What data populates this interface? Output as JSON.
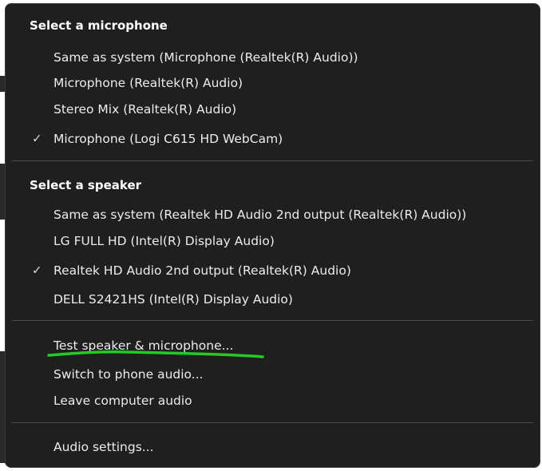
{
  "mic_section": {
    "title": "Select a microphone",
    "items": [
      {
        "label": "Same as system (Microphone (Realtek(R) Audio))",
        "checked": false
      },
      {
        "label": "Microphone (Realtek(R) Audio)",
        "checked": false
      },
      {
        "label": "Stereo Mix (Realtek(R) Audio)",
        "checked": false
      },
      {
        "label": "Microphone (Logi C615 HD WebCam)",
        "checked": true
      }
    ]
  },
  "speaker_section": {
    "title": "Select a speaker",
    "items": [
      {
        "label": "Same as system (Realtek HD Audio 2nd output (Realtek(R) Audio))",
        "checked": false
      },
      {
        "label": "LG FULL HD (Intel(R) Display Audio)",
        "checked": false
      },
      {
        "label": "Realtek HD Audio 2nd output (Realtek(R) Audio)",
        "checked": true
      },
      {
        "label": "DELL S2421HS (Intel(R) Display Audio)",
        "checked": false
      }
    ]
  },
  "actions": {
    "test": "Test speaker & microphone...",
    "switch_phone": "Switch to phone audio...",
    "leave": "Leave computer audio"
  },
  "settings": {
    "audio_settings": "Audio settings..."
  },
  "check_glyph": "✓",
  "colors": {
    "menu_bg": "#1f1f1f",
    "text": "#ececec",
    "divider": "#4a4a4a",
    "highlight_mark": "#22cc22"
  }
}
